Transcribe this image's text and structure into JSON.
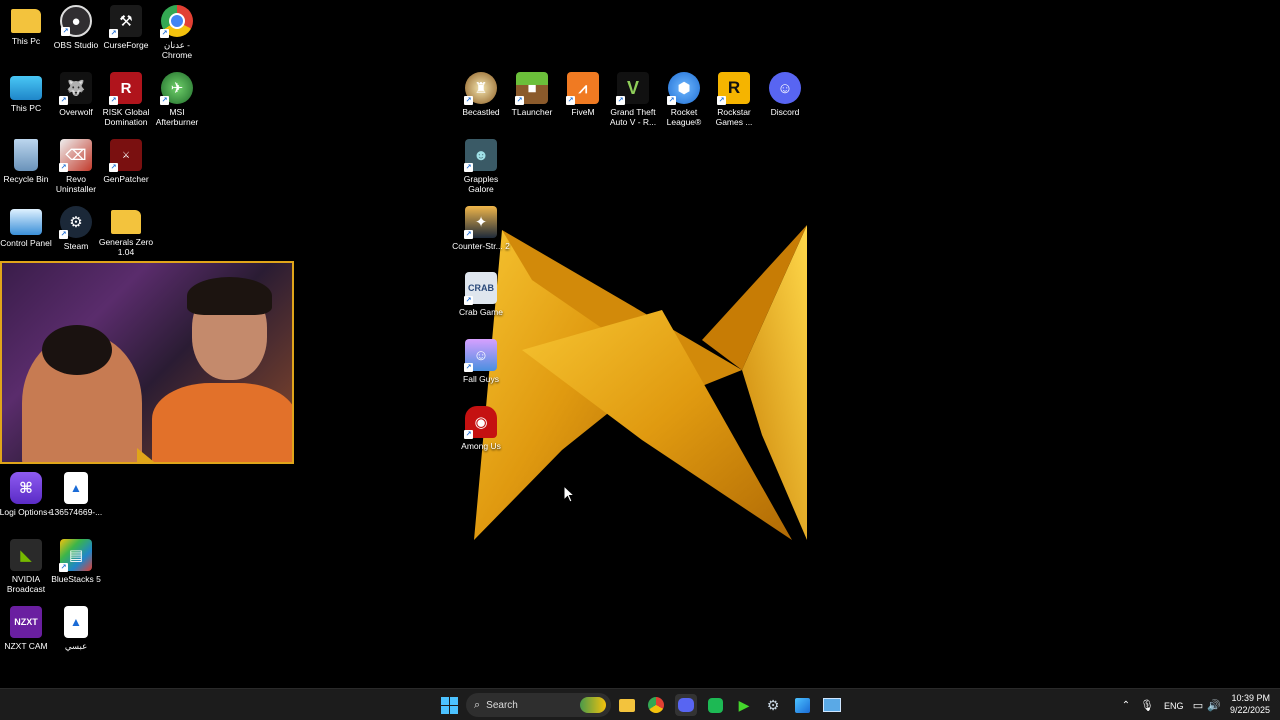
{
  "desktop_icons": [
    {
      "id": "this-pc-folder",
      "label": "This Pc",
      "icon": "folder-icon",
      "color": "#f3c33d"
    },
    {
      "id": "obs",
      "label": "OBS Studio",
      "icon": "obs-icon",
      "color": "#302e31"
    },
    {
      "id": "curseforge",
      "label": "CurseForge",
      "icon": "curseforge-icon",
      "color": "#1a1a1a"
    },
    {
      "id": "chrome",
      "label": "عدنان - Chrome",
      "icon": "chrome-icon",
      "color": "#e24033"
    },
    {
      "id": "this-pc",
      "label": "This PC",
      "icon": "monitor-icon",
      "color": "#2aa7e0"
    },
    {
      "id": "overwolf",
      "label": "Overwolf",
      "icon": "overwolf-icon",
      "color": "#111111"
    },
    {
      "id": "risk",
      "label": "RISK Global Domination",
      "icon": "risk-icon",
      "color": "#b0141c"
    },
    {
      "id": "msi",
      "label": "MSI Afterburner",
      "icon": "msi-icon",
      "color": "#2e8a3c"
    },
    {
      "id": "recycle",
      "label": "Recycle Bin",
      "icon": "recycle-bin-icon",
      "color": "#8fb6d8"
    },
    {
      "id": "revo",
      "label": "Revo Uninstaller",
      "icon": "revo-icon",
      "color": "#c23a2b"
    },
    {
      "id": "genpatcher",
      "label": "GenPatcher",
      "icon": "genpatcher-icon",
      "color": "#7a1010"
    },
    {
      "id": "control-panel",
      "label": "Control Panel",
      "icon": "control-panel-icon",
      "color": "#3a8fd8"
    },
    {
      "id": "steam",
      "label": "Steam",
      "icon": "steam-icon",
      "color": "#1b2838"
    },
    {
      "id": "generals",
      "label": "Generals Zero 1.04",
      "icon": "folder-icon",
      "color": "#f3c33d"
    },
    {
      "id": "logi",
      "label": "Logi Options+",
      "icon": "logi-icon",
      "color": "#6a3bd6"
    },
    {
      "id": "image1",
      "label": "136574669-...",
      "icon": "image-file-icon",
      "color": "#ffffff"
    },
    {
      "id": "nvidia",
      "label": "NVIDIA Broadcast",
      "icon": "nvidia-icon",
      "color": "#2a2a2a"
    },
    {
      "id": "bluestacks",
      "label": "BlueStacks 5",
      "icon": "bluestacks-icon",
      "color": "#3bb54a"
    },
    {
      "id": "nzxt",
      "label": "NZXT CAM",
      "icon": "nzxt-icon",
      "color": "#6a1fa0"
    },
    {
      "id": "image2",
      "label": "عبسي",
      "icon": "image-file-icon",
      "color": "#ffffff"
    },
    {
      "id": "becastled",
      "label": "Becastled",
      "icon": "becastled-icon",
      "color": "#d8b24a"
    },
    {
      "id": "tlauncher",
      "label": "TLauncher",
      "icon": "minecraft-icon",
      "color": "#5c9a33"
    },
    {
      "id": "fivem",
      "label": "FiveM",
      "icon": "fivem-icon",
      "color": "#f07a22"
    },
    {
      "id": "gta",
      "label": "Grand Theft Auto V - R...",
      "icon": "gta-icon",
      "color": "#111111"
    },
    {
      "id": "rocket",
      "label": "Rocket League®",
      "icon": "rocket-league-icon",
      "color": "#1f6ed4"
    },
    {
      "id": "rockstar",
      "label": "Rockstar Games ...",
      "icon": "rockstar-icon",
      "color": "#f5b400"
    },
    {
      "id": "discord",
      "label": "Discord",
      "icon": "discord-icon",
      "color": "#5865f2"
    },
    {
      "id": "grapples",
      "label": "Grapples Galore",
      "icon": "grapples-icon",
      "color": "#7fc4c9"
    },
    {
      "id": "cs2",
      "label": "Counter-Str... 2",
      "icon": "counter-strike-icon",
      "color": "#e5a23a"
    },
    {
      "id": "crab",
      "label": "Crab Game",
      "icon": "crab-game-icon",
      "color": "#dfe6ee"
    },
    {
      "id": "fallguys",
      "label": "Fall Guys",
      "icon": "fall-guys-icon",
      "color": "#9b59d0"
    },
    {
      "id": "amongus",
      "label": "Among Us",
      "icon": "among-us-icon",
      "color": "#c51111"
    }
  ],
  "taskbar": {
    "search_label": "Search",
    "language": "ENG",
    "time": "10:39 PM",
    "date": "9/22/2025",
    "apps": [
      "file-explorer-icon",
      "chrome-icon",
      "discord-icon",
      "spotify-icon",
      "razer-icon",
      "steam-icon",
      "paint-icon",
      "remote-desktop-icon"
    ]
  },
  "colors": {
    "accent": "#e0a51a",
    "taskbar": "#1c1c1c"
  }
}
